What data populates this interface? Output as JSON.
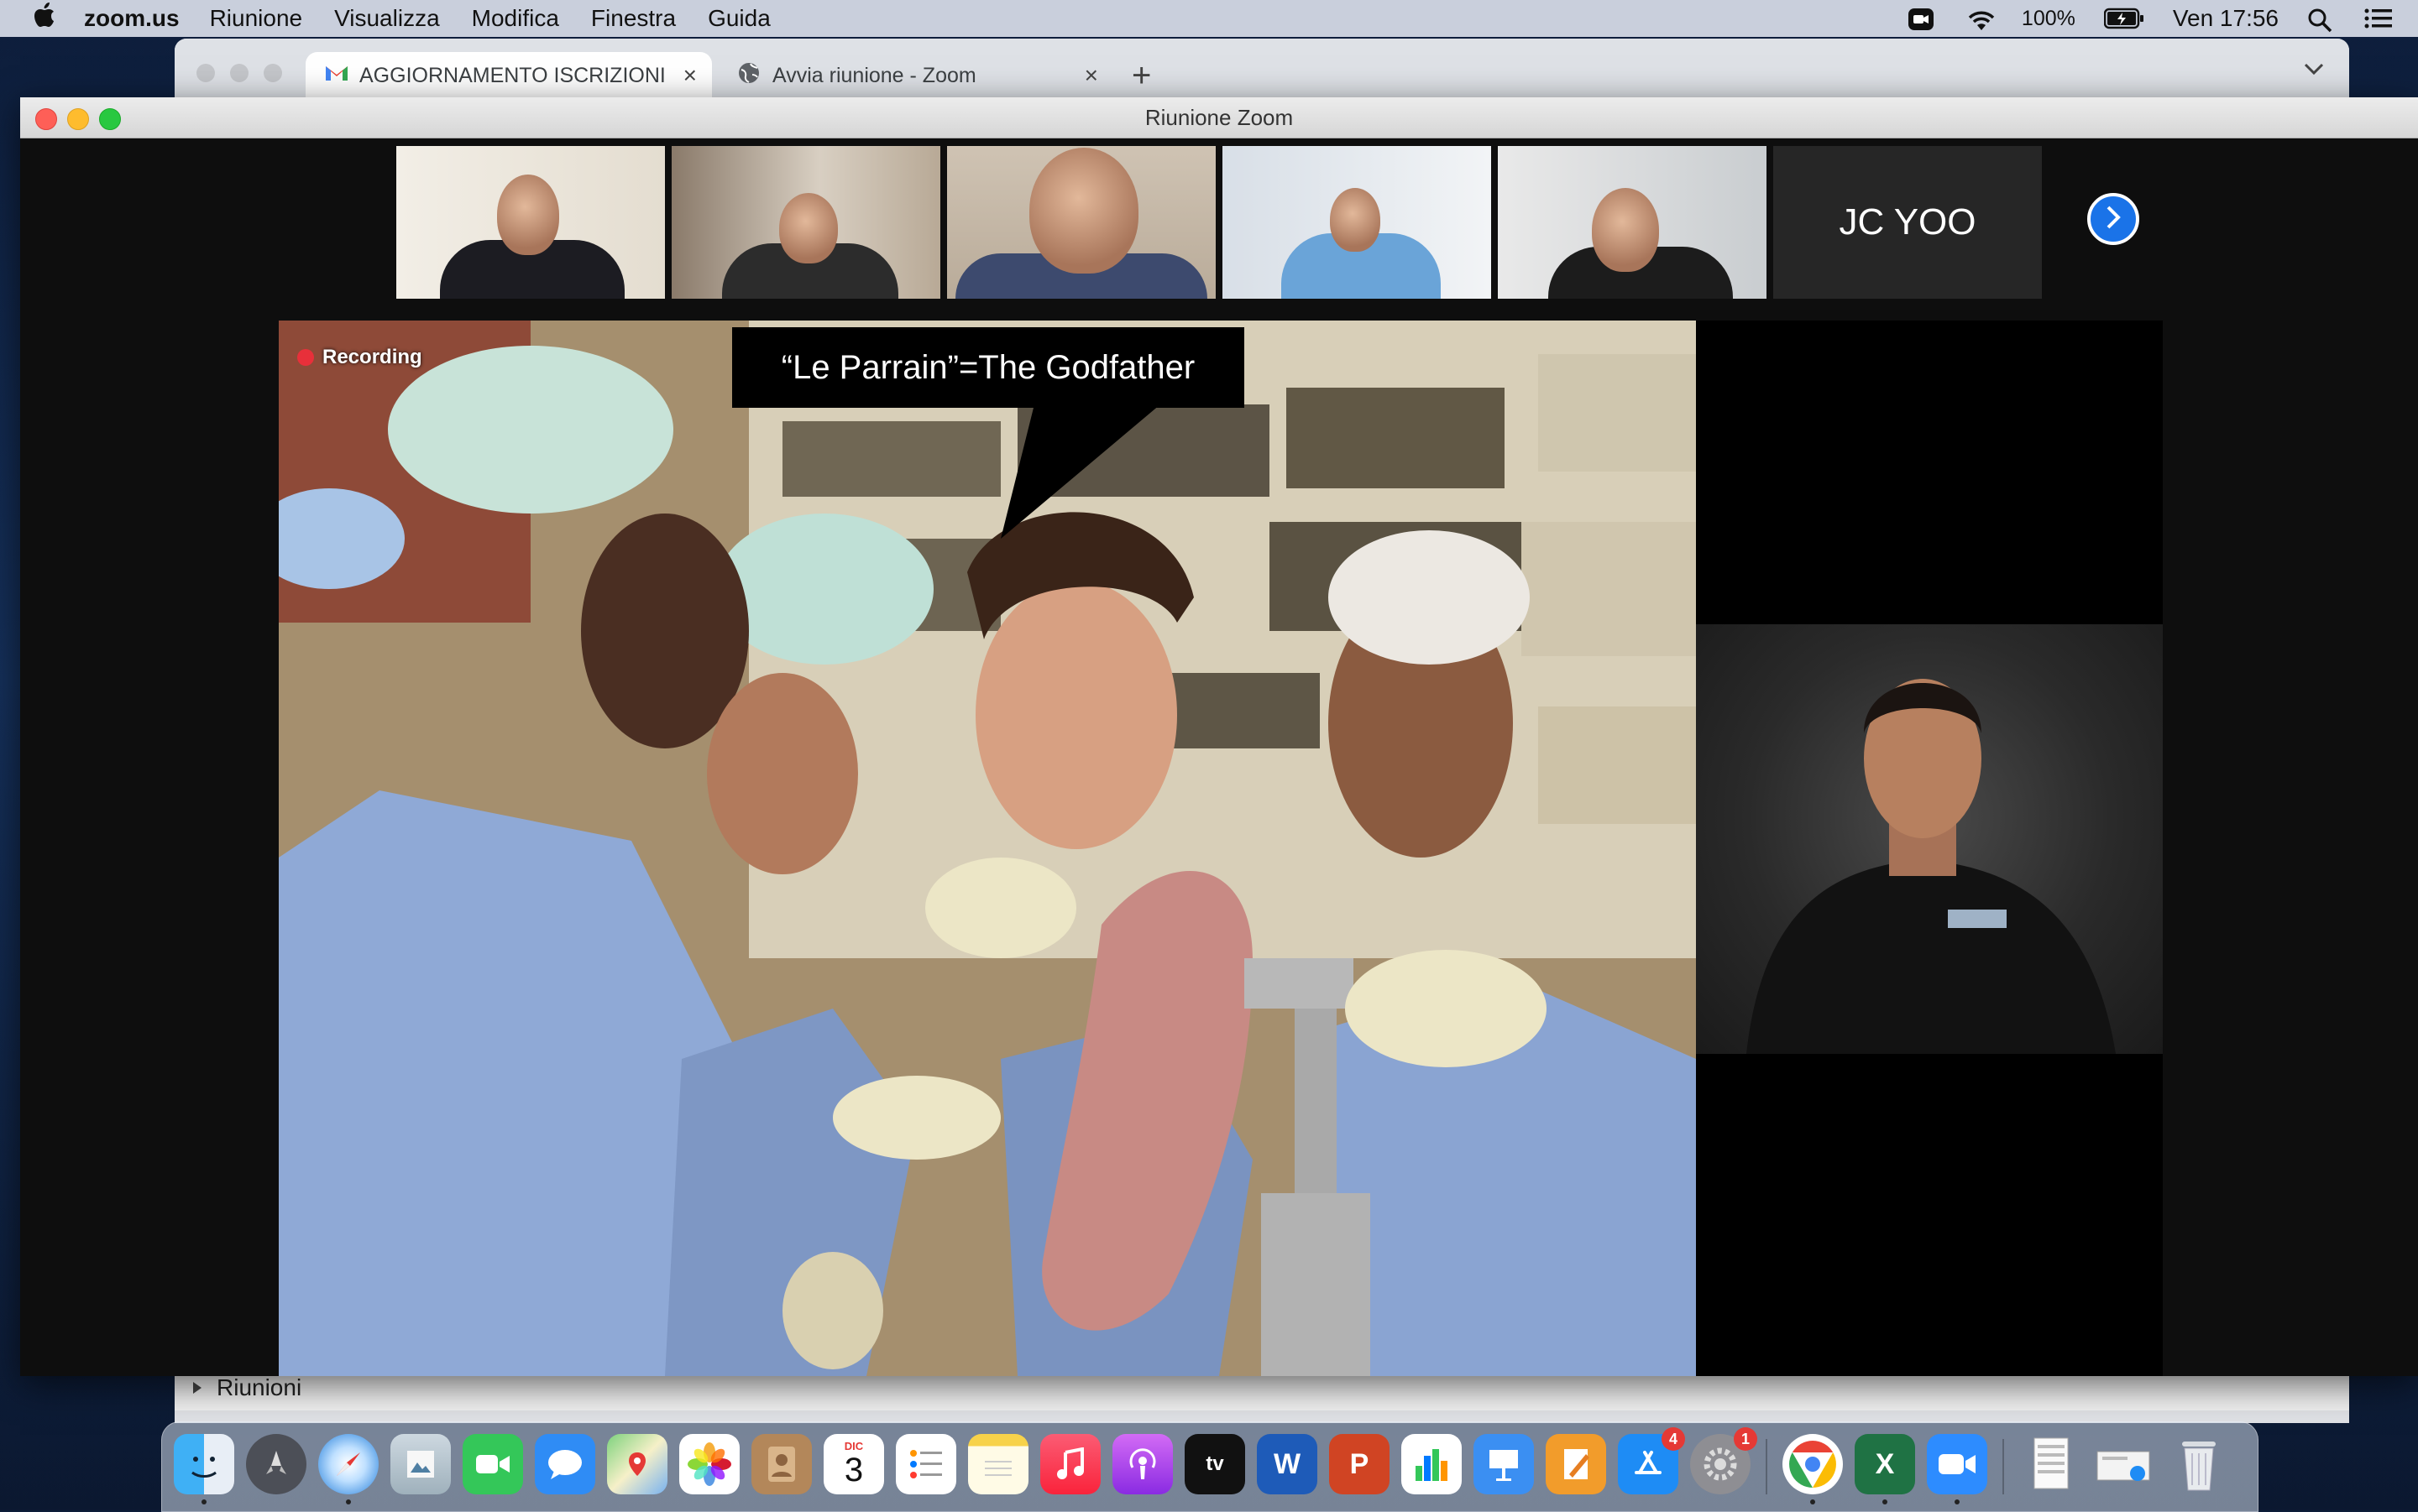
{
  "menubar": {
    "apple": "",
    "app_name": "zoom.us",
    "menus": [
      "Riunione",
      "Visualizza",
      "Modifica",
      "Finestra",
      "Guida"
    ],
    "battery": "100%",
    "clock": "Ven 17:56"
  },
  "browser": {
    "tabs": [
      {
        "label": "AGGIORNAMENTO ISCRIZIONI",
        "icon": "gmail-icon"
      },
      {
        "label": "Avvia riunione - Zoom",
        "icon": "globe-icon"
      }
    ],
    "new_tab": "+",
    "bottom_section": "Riunioni"
  },
  "zoom": {
    "window_title": "Riunione Zoom",
    "participant_name_tile": "JC YOO",
    "recording_label": "Recording",
    "caption": "“Le Parrain”=The Godfather"
  },
  "dock": {
    "calendar_month": "DIC",
    "calendar_day": "3",
    "appstore_badge": "4",
    "settings_badge": "1",
    "tv_label": "tv",
    "word_letter": "W",
    "ppt_letter": "P",
    "excel_letter": "X"
  }
}
